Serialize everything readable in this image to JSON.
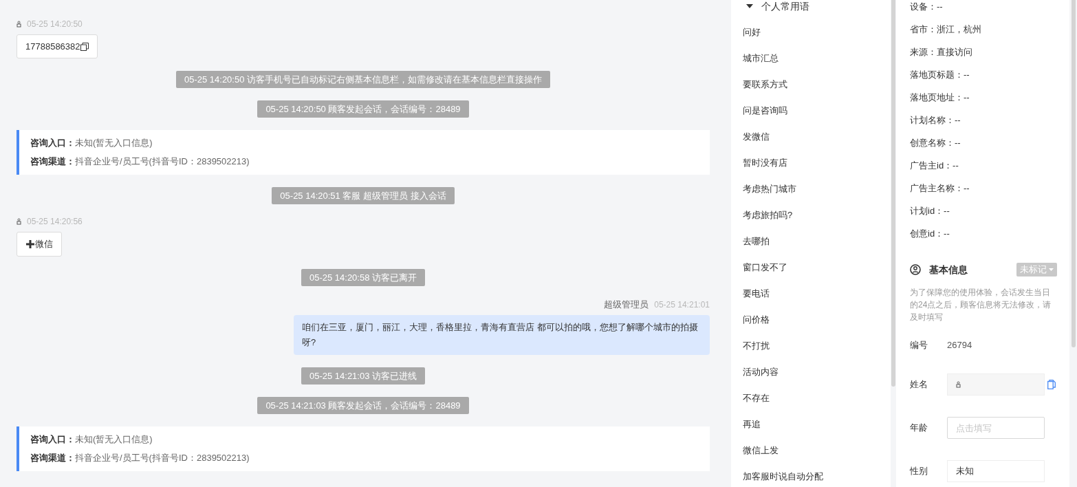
{
  "chat": {
    "messages": [
      {
        "kind": "phone",
        "time": "05-25 14:20:50",
        "text": "17788586382"
      },
      {
        "kind": "system",
        "text": "05-25 14:20:50 访客手机号已自动标记右侧基本信息栏，如需修改请在基本信息栏直接操作"
      },
      {
        "kind": "system",
        "text": "05-25 14:20:50 顾客发起会话，会话编号：28489"
      },
      {
        "kind": "entry",
        "rows": [
          {
            "label": "咨询入口：",
            "value": "未知(暂无入口信息)"
          },
          {
            "label": "咨询渠道：",
            "value": "抖音企业号/员工号(抖音号ID：2839502213)"
          }
        ]
      },
      {
        "kind": "system",
        "text": "05-25 14:20:51 客服 超级管理员 接入会话"
      },
      {
        "kind": "add",
        "time": "05-25 14:20:56",
        "text": "微信"
      },
      {
        "kind": "system",
        "text": "05-25 14:20:58 访客已离开"
      },
      {
        "kind": "agent",
        "sender": "超级管理员",
        "time": "05-25 14:21:01",
        "text": "咱们在三亚，厦门，丽江，大理，香格里拉，青海有直营店 都可以拍的哦，您想了解哪个城市的拍摄呀?"
      },
      {
        "kind": "system",
        "text": "05-25 14:21:03 访客已进线"
      },
      {
        "kind": "system",
        "text": "05-25 14:21:03 顾客发起会话，会话编号：28489"
      },
      {
        "kind": "entry",
        "rows": [
          {
            "label": "咨询入口：",
            "value": "未知(暂无入口信息)"
          },
          {
            "label": "咨询渠道：",
            "value": "抖音企业号/员工号(抖音号ID：2839502213)"
          }
        ]
      }
    ]
  },
  "phrases": {
    "group": {
      "title": "个人常用语",
      "expanded": true
    },
    "items": [
      "问好",
      "城市汇总",
      "要联系方式",
      "问是咨询吗",
      "发微信",
      "暂时没有店",
      "考虑热门城市",
      "考虑旅拍吗?",
      "去哪拍",
      "窗口发不了",
      "要电话",
      "问价格",
      "不打扰",
      "活动内容",
      "不存在",
      "再追",
      "微信上发",
      "加客服时说自动分配"
    ]
  },
  "visitor_info": {
    "rows": [
      "设备：--",
      "省市：浙江，杭州",
      "来源：直接访问",
      "落地页标题：--",
      "落地页地址：--",
      "计划名称：--",
      "创意名称：--",
      "广告主id：--",
      "广告主名称：--",
      "计划id：--",
      "创意id：--"
    ]
  },
  "basic_info": {
    "title": "基本信息",
    "tag": "未标记",
    "note": "为了保障您的使用体验，会话发生当日的24点之后，顾客信息将无法修改，请及时填写",
    "fields": [
      {
        "kind": "text",
        "label": "编号",
        "value": "26794"
      },
      {
        "kind": "name",
        "label": "姓名"
      },
      {
        "kind": "input",
        "label": "年龄",
        "placeholder": "点击填写"
      },
      {
        "kind": "select",
        "label": "性别",
        "value": "未知"
      }
    ]
  }
}
